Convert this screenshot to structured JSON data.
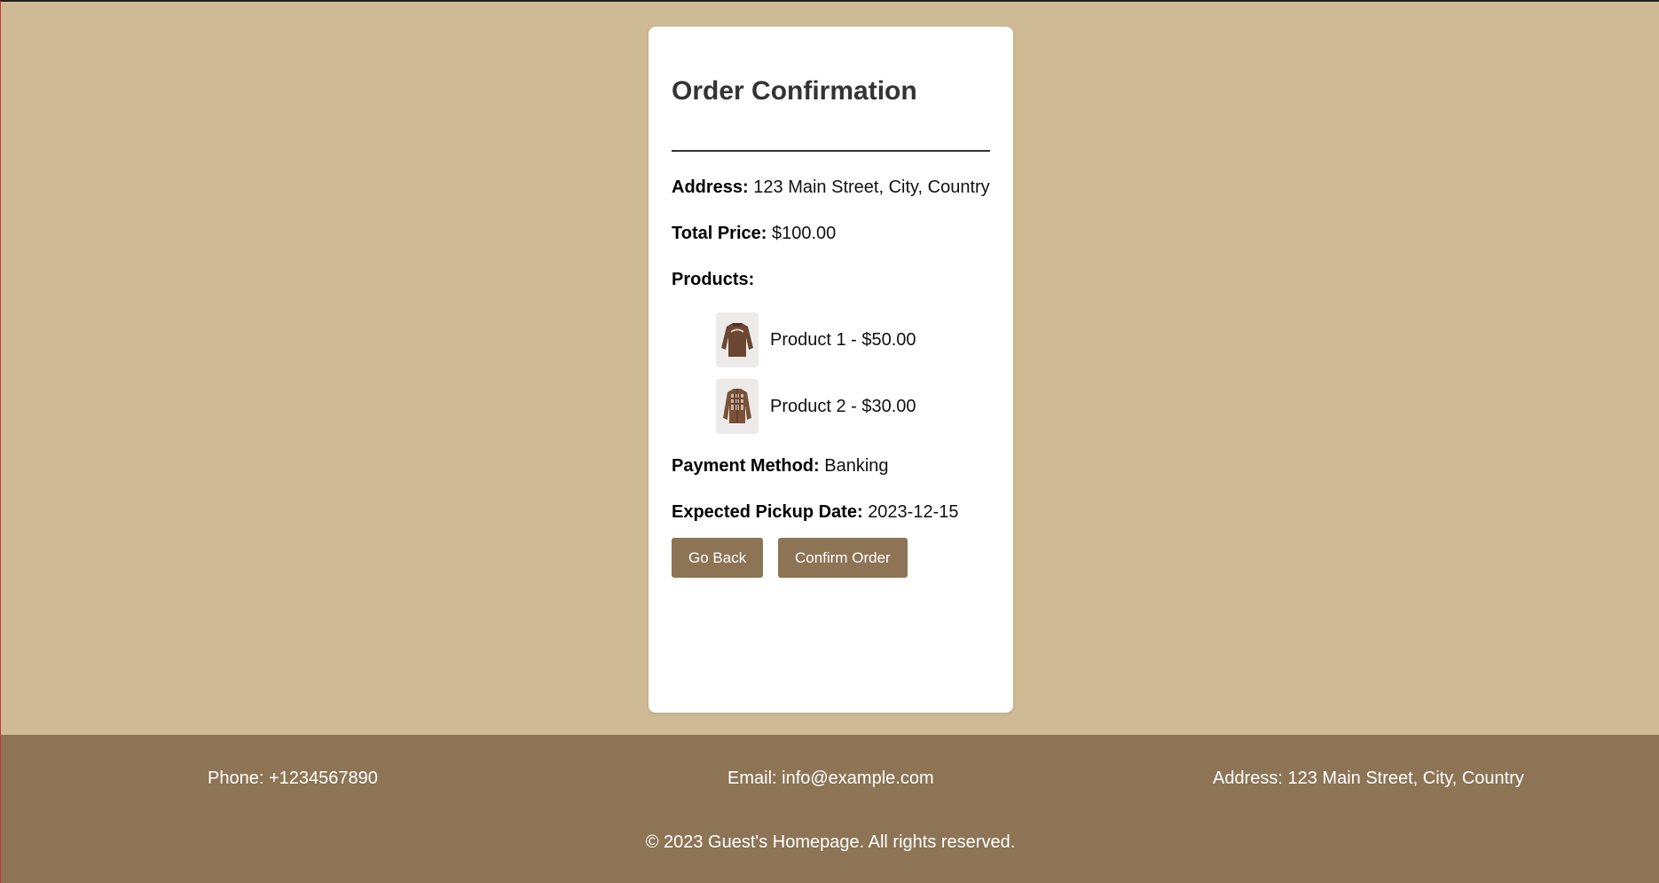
{
  "order": {
    "title": "Order Confirmation",
    "address_label": "Address:",
    "address_value": "123 Main Street, City, Country",
    "total_label": "Total Price:",
    "total_value": "$100.00",
    "products_label": "Products:",
    "products": [
      {
        "label": "Product 1 - $50.00",
        "icon": "sweater-thumbnail"
      },
      {
        "label": "Product 2 - $30.00",
        "icon": "plaid-jacket-thumbnail"
      }
    ],
    "payment_label": "Payment Method:",
    "payment_value": "Banking",
    "pickup_label": "Expected Pickup Date:",
    "pickup_value": "2023-12-15",
    "back_button": "Go Back",
    "confirm_button": "Confirm Order"
  },
  "footer": {
    "phone": "Phone: +1234567890",
    "email": "Email: info@example.com",
    "address": "Address: 123 Main Street, City, Country",
    "copyright": "© 2023 Guest's Homepage. All rights reserved."
  },
  "colors": {
    "background": "#cebb96",
    "accent": "#8c7455",
    "card": "#ffffff"
  }
}
